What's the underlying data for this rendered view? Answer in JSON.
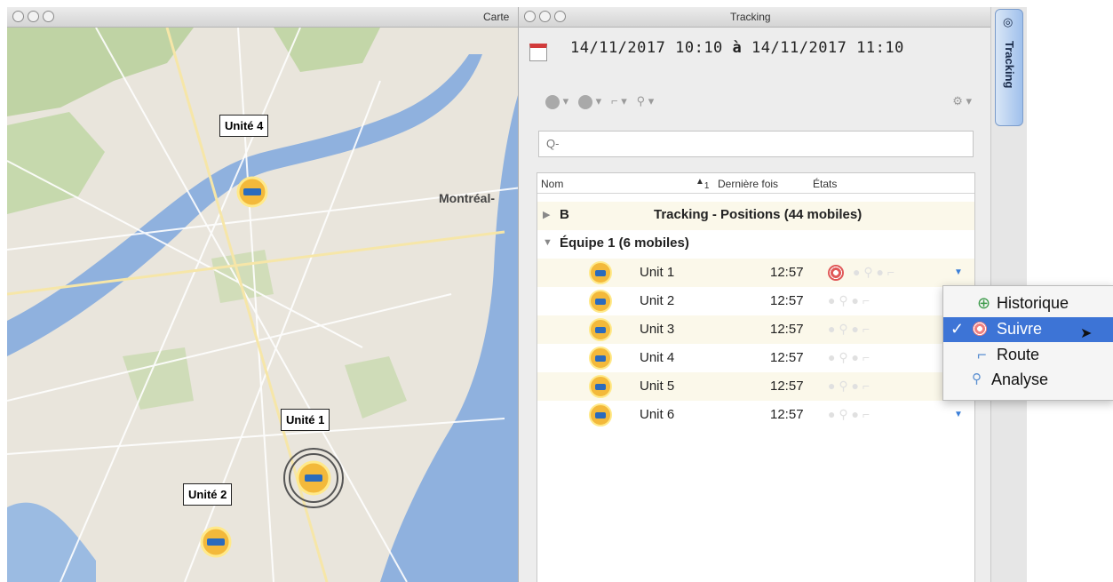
{
  "map_window": {
    "title": "Carte",
    "city_label": "Montréal-",
    "unit_labels": [
      "Unité 4",
      "Unité 1",
      "Unité 2"
    ]
  },
  "tracking_window": {
    "title": "Tracking",
    "date_range": {
      "from_date": "14/11/2017",
      "from_time": "10:10",
      "sep": "à",
      "to_date": "14/11/2017",
      "to_time": "11:10"
    },
    "search": {
      "placeholder": "Q-"
    },
    "columns": {
      "name": "Nom",
      "sort": "1",
      "last_time": "Dernière fois",
      "states": "États"
    },
    "group_b": {
      "toggle": "▶",
      "label": "B",
      "summary": "Tracking - Positions (44 mobiles)"
    },
    "group_team": {
      "toggle": "▼",
      "label": "Équipe 1 (6 mobiles)"
    },
    "units": [
      {
        "name": "Unit 1",
        "time": "12:57"
      },
      {
        "name": "Unit 2",
        "time": "12:57"
      },
      {
        "name": "Unit 3",
        "time": "12:57"
      },
      {
        "name": "Unit 4",
        "time": "12:57"
      },
      {
        "name": "Unit 5",
        "time": "12:57"
      },
      {
        "name": "Unit 6",
        "time": "12:57"
      }
    ]
  },
  "side_tab": {
    "label": "Tracking"
  },
  "context_menu": {
    "items": [
      {
        "label": "Historique",
        "icon": "history-icon"
      },
      {
        "label": "Suivre",
        "icon": "target-icon",
        "checked": "✓"
      },
      {
        "label": "Route",
        "icon": "route-icon"
      },
      {
        "label": "Analyse",
        "icon": "analysis-icon"
      }
    ]
  },
  "colors": {
    "accent": "#3d74d6",
    "river": "#8fb1de",
    "taxi": "#f3b93b"
  }
}
